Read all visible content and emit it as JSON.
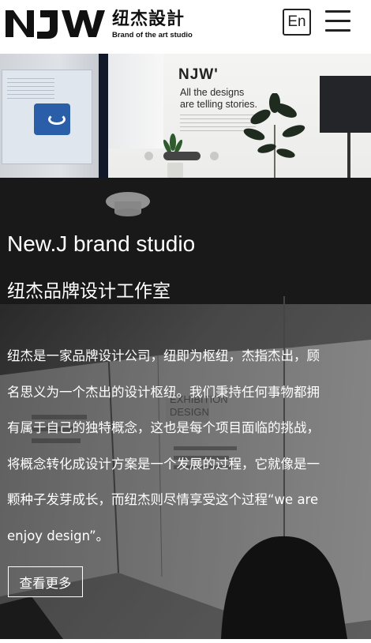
{
  "header": {
    "logo_mark": "NJW",
    "logo_cn": "纽杰設計",
    "logo_en": "Brand of the art studio",
    "lang_label": "En",
    "menu_icon": "hamburger-menu-icon"
  },
  "banner": {
    "logo": "NJW'",
    "headline_line1": "All the designs",
    "headline_line2": "are telling stories.",
    "slide_count": 3,
    "active_slide": 2
  },
  "about": {
    "title_en": "New.J brand studio",
    "title_cn": "纽杰品牌设计工作室",
    "body_lines": [
      "纽杰是一家品牌设计公司，纽即为枢纽，杰指杰出，顾",
      "名思义为一个杰出的设计枢纽。我们秉持任何事物都拥",
      "有属于自己的独特概念，这也是每个项目面临的挑战，",
      "将概念转化成设计方案是一个发展的过程，它就像是一",
      "颗种子发芽成长，而纽杰则尽情享受这个过程“we are",
      "enjoy design”。"
    ],
    "more_label": "查看更多"
  },
  "colors": {
    "header_bg": "#ffffff",
    "text_dark": "#111111",
    "about_overlay": "#4a4a4a",
    "white": "#ffffff",
    "dot_active": "#444444",
    "dot_inactive": "#c9c9c9"
  }
}
